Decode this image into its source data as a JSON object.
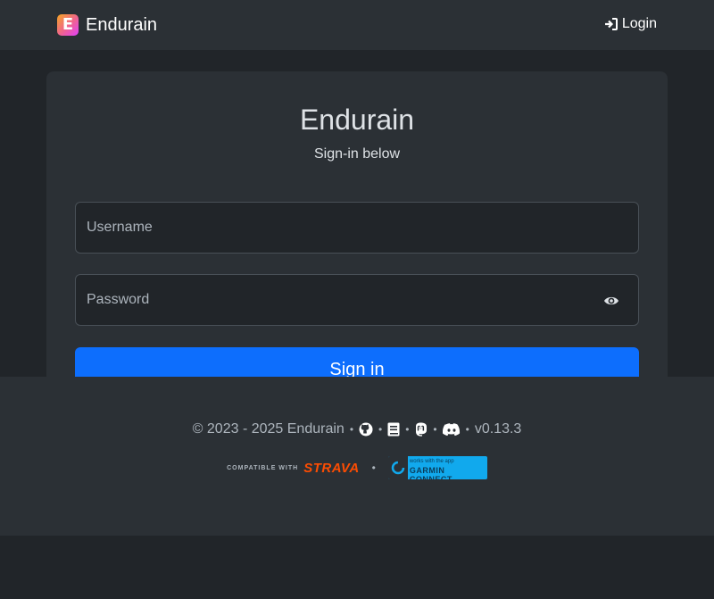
{
  "navbar": {
    "brand_letter": "E",
    "brand_name": "Endurain",
    "login_label": "Login"
  },
  "card": {
    "title": "Endurain",
    "subtitle": "Sign-in below",
    "username_placeholder": "Username",
    "password_placeholder": "Password",
    "signin_label": "Sign in"
  },
  "footer": {
    "copyright": "© 2023 - 2025 Endurain",
    "version": "v0.13.3",
    "strava_small": "COMPATIBLE WITH",
    "strava_word": "STRAVA",
    "garmin_top": "works with the app",
    "garmin_name": "GARMIN CONNECT"
  },
  "icons": [
    "brand-logo-icon",
    "login-icon",
    "eye-icon",
    "github-icon",
    "book-icon",
    "mastodon-icon",
    "discord-icon",
    "garmin-connect-icon"
  ],
  "colors": {
    "background": "#212529",
    "surface": "#2b3035",
    "input_bg": "#212529",
    "primary": "#0d6efd",
    "strava": "#fc4c02",
    "garmin": "#11a9ed"
  }
}
